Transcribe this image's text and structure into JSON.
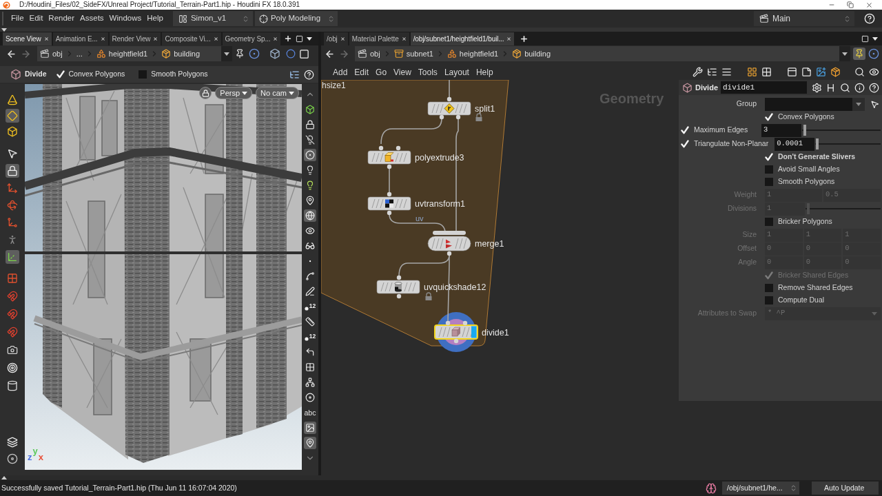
{
  "title_bar": {
    "title": "D:/Houdini_Files/02_SideFX/Unreal Project/Tutorial_Terrain-Part1.hip - Houdini FX 18.0.391"
  },
  "menu_bar": {
    "menus": [
      "File",
      "Edit",
      "Render",
      "Assets",
      "Windows",
      "Help"
    ],
    "desktop": "Simon_v1",
    "shelf_set": "Poly Modeling",
    "context": "Main"
  },
  "left_pane": {
    "tabs": [
      {
        "label": "Scene View",
        "selected": true
      },
      {
        "label": "Animation E...",
        "selected": false
      },
      {
        "label": "Render View",
        "selected": false
      },
      {
        "label": "Composite Vi...",
        "selected": false
      },
      {
        "label": "Geometry Sp...",
        "selected": false
      }
    ],
    "path": [
      {
        "kind": "object",
        "label": "obj"
      },
      {
        "kind": "more",
        "label": "..."
      },
      {
        "kind": "heightfield",
        "label": "heightfield1"
      },
      {
        "kind": "geometry",
        "label": "building"
      }
    ],
    "pinned": false,
    "operation": {
      "title": "Divide",
      "toggles": [
        {
          "label": "Convex Polygons",
          "checked": true
        },
        {
          "label": "Smooth Polygons",
          "checked": false
        }
      ]
    },
    "viewport": {
      "camera_menus": [
        "Persp",
        "No cam"
      ],
      "axes": [
        {
          "label": "y",
          "color": "#5cc85c"
        },
        {
          "label": "z",
          "color": "#4a6fe3"
        },
        {
          "label": "x",
          "color": "#e8513a"
        }
      ],
      "left_tools": [
        {
          "kind": "cone",
          "on": false
        },
        {
          "kind": "diamond",
          "on": true
        },
        {
          "kind": "cube",
          "on": false
        },
        {
          "kind": "pointer",
          "on": false
        },
        {
          "kind": "lock",
          "on": true
        },
        {
          "kind": "move",
          "on": false
        },
        {
          "kind": "rotate",
          "on": false
        },
        {
          "kind": "scale",
          "on": false
        },
        {
          "kind": "figure",
          "on": false
        },
        {
          "kind": "axes",
          "on": true
        },
        {
          "kind": "grid",
          "on": false
        },
        {
          "kind": "magnet",
          "on": false
        },
        {
          "kind": "magnet",
          "on": false
        },
        {
          "kind": "magnet",
          "on": false
        },
        {
          "kind": "camera",
          "on": false
        },
        {
          "kind": "target",
          "on": false
        },
        {
          "kind": "cylinder",
          "on": false
        },
        {
          "kind": "stack",
          "on": false
        },
        {
          "kind": "disc",
          "on": false
        }
      ],
      "right_tools": [
        {
          "kind": "up",
          "on": false
        },
        {
          "kind": "wire_box",
          "on": false
        },
        {
          "kind": "lock",
          "on": false
        },
        {
          "kind": "bulb_off",
          "on": false
        },
        {
          "kind": "ring",
          "on": true
        },
        {
          "kind": "bulb",
          "on": false
        },
        {
          "kind": "bulb_plus",
          "on": false
        },
        {
          "kind": "pin",
          "on": false
        },
        {
          "kind": "sphere",
          "on": true
        },
        {
          "kind": "eye",
          "on": false
        },
        {
          "kind": "glasses",
          "on": false
        },
        {
          "kind": "dot",
          "on": false
        },
        {
          "kind": "curve",
          "on": false
        },
        {
          "kind": "pen",
          "on": false
        },
        {
          "kind": "numbered",
          "label": "12",
          "on": false
        },
        {
          "kind": "ruler",
          "on": false
        },
        {
          "kind": "numbered",
          "label": "12",
          "on": false
        },
        {
          "kind": "corner",
          "on": false
        },
        {
          "kind": "squares",
          "on": false
        },
        {
          "kind": "joint",
          "on": false
        },
        {
          "kind": "disc",
          "on": false
        },
        {
          "kind": "text",
          "label": "abc",
          "on": false
        },
        {
          "kind": "image",
          "on": true
        },
        {
          "kind": "pin",
          "on": true
        },
        {
          "kind": "down",
          "on": false
        }
      ]
    }
  },
  "right_pane": {
    "tabs": [
      {
        "label": "/obj",
        "selected": false
      },
      {
        "label": "Material Palette",
        "selected": false
      },
      {
        "label": "/obj/subnet1/heightfield1/buil...",
        "selected": true
      }
    ],
    "path": [
      {
        "kind": "object",
        "label": "obj"
      },
      {
        "kind": "subnet",
        "label": "subnet1"
      },
      {
        "kind": "heightfield",
        "label": "heightfield1"
      },
      {
        "kind": "geometry",
        "label": "building"
      }
    ],
    "pinned": true,
    "menus": [
      "Add",
      "Edit",
      "Go",
      "View",
      "Tools",
      "Layout",
      "Help"
    ],
    "network": {
      "context": "Geometry",
      "box_label": "hsize1",
      "wire_labels": [
        "uv"
      ],
      "nodes": [
        {
          "name": "split1",
          "kind": "split",
          "selected": false,
          "display": false,
          "locked": true
        },
        {
          "name": "polyextrude3",
          "kind": "polyextrude",
          "selected": false,
          "display": false,
          "locked": false
        },
        {
          "name": "uvtransform1",
          "kind": "uvtransform",
          "selected": false,
          "display": false,
          "locked": false
        },
        {
          "name": "merge1",
          "kind": "merge",
          "selected": false,
          "display": false,
          "locked": false
        },
        {
          "name": "uvquickshade12",
          "kind": "uvquickshade",
          "selected": false,
          "display": false,
          "locked": true
        },
        {
          "name": "divide1",
          "kind": "divide",
          "selected": true,
          "display": true,
          "locked": false
        }
      ]
    },
    "parameters": {
      "node_type": "Divide",
      "node_name": "divide1",
      "rows": [
        {
          "kind": "group",
          "label": "Group",
          "disabled": false,
          "modified": false
        },
        {
          "kind": "toggle",
          "label": "Convex Polygons",
          "checked": true,
          "disabled": false,
          "modified": false
        },
        {
          "kind": "slider",
          "label": "Maximum Edges",
          "checked": true,
          "value": "3",
          "level": 0.02,
          "disabled": false,
          "modified": false
        },
        {
          "kind": "slider",
          "label": "Triangulate Non-Planar",
          "checked": true,
          "value": "0.0001",
          "level": 0.01,
          "disabled": false,
          "modified": false
        },
        {
          "kind": "toggle",
          "label": "Don't Generate Slivers",
          "checked": true,
          "disabled": false,
          "modified": true
        },
        {
          "kind": "toggle",
          "label": "Avoid Small Angles",
          "checked": false,
          "disabled": false,
          "modified": false
        },
        {
          "kind": "toggle",
          "label": "Smooth Polygons",
          "checked": false,
          "disabled": false,
          "modified": false
        },
        {
          "kind": "vector",
          "label": "Weight",
          "values": [
            "1",
            "0.5"
          ],
          "disabled": true,
          "modified": false
        },
        {
          "kind": "slider",
          "label": "Divisions",
          "value": "1",
          "level": 0.02,
          "disabled": true,
          "modified": false
        },
        {
          "kind": "toggle",
          "label": "Bricker Polygons",
          "checked": false,
          "disabled": false,
          "modified": false
        },
        {
          "kind": "vector",
          "label": "Size",
          "values": [
            "1",
            "1",
            "1"
          ],
          "disabled": true,
          "modified": false
        },
        {
          "kind": "vector",
          "label": "Offset",
          "values": [
            "0",
            "0",
            "0"
          ],
          "disabled": true,
          "modified": false
        },
        {
          "kind": "vector",
          "label": "Angle",
          "values": [
            "0",
            "0",
            "0"
          ],
          "disabled": true,
          "modified": false
        },
        {
          "kind": "toggle",
          "label": "Bricker Shared Edges",
          "checked": true,
          "disabled": true,
          "modified": false
        },
        {
          "kind": "toggle",
          "label": "Remove Shared Edges",
          "checked": false,
          "disabled": false,
          "modified": false
        },
        {
          "kind": "toggle",
          "label": "Compute Dual",
          "checked": false,
          "disabled": false,
          "modified": false
        },
        {
          "kind": "menu",
          "label": "Attributes to Swap",
          "value": "* ^P",
          "disabled": true,
          "modified": false
        }
      ]
    }
  },
  "status_bar": {
    "message": "Successfully saved Tutorial_Terrain-Part1.hip (Thu Jun 11 16:07:04 2020)",
    "path": "/obj/subnet1/he...",
    "update_mode": "Auto Update"
  }
}
